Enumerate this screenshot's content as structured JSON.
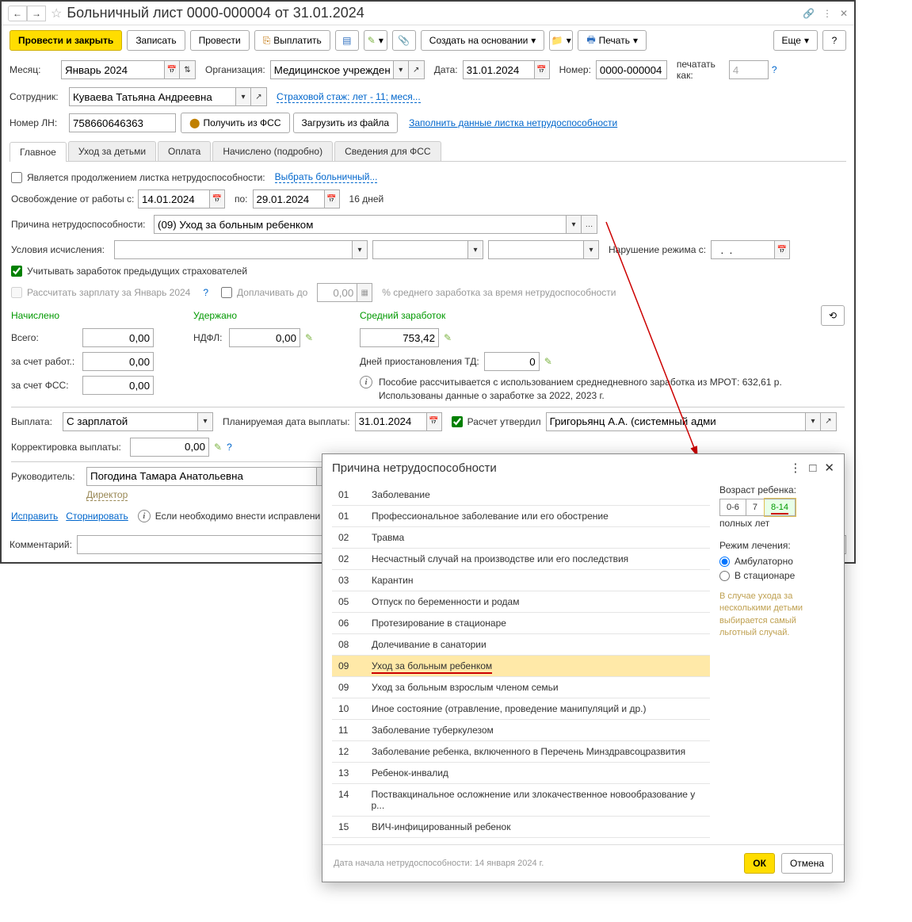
{
  "title": "Больничный лист 0000-000004 от 31.01.2024",
  "toolbar": {
    "post_close": "Провести и закрыть",
    "write": "Записать",
    "post": "Провести",
    "pay": "Выплатить",
    "create_based": "Создать на основании",
    "print": "Печать",
    "more": "Еще",
    "help": "?"
  },
  "fields": {
    "month_lbl": "Месяц:",
    "month": "Январь 2024",
    "org_lbl": "Организация:",
    "org": "Медицинское учреждение",
    "date_lbl": "Дата:",
    "date": "31.01.2024",
    "number_lbl": "Номер:",
    "number": "0000-000004",
    "print_as_lbl": "печатать как:",
    "print_as": "4",
    "employee_lbl": "Сотрудник:",
    "employee": "Куваева Татьяна Андреевна",
    "insurance_link": "Страховой стаж: лет - 11; меся...",
    "ln_lbl": "Номер ЛН:",
    "ln": "758660646363",
    "get_fss": "Получить из ФСС",
    "load_file": "Загрузить из файла",
    "fill_link": "Заполнить данные листка нетрудоспособности"
  },
  "tabs": [
    "Главное",
    "Уход за детьми",
    "Оплата",
    "Начислено (подробно)",
    "Сведения для ФСС"
  ],
  "main": {
    "continuation_lbl": "Является продолжением листка нетрудоспособности:",
    "select_sick": "Выбрать больничный...",
    "release_lbl": "Освобождение от работы с:",
    "date_from": "14.01.2024",
    "to_lbl": "по:",
    "date_to": "29.01.2024",
    "days": "16 дней",
    "reason_lbl": "Причина нетрудоспособности:",
    "reason": "(09) Уход за больным ребенком",
    "conditions_lbl": "Условия исчисления:",
    "violation_lbl": "Нарушение режима с:",
    "violation_date": "  .  .    ",
    "consider_prev": "Учитывать заработок предыдущих страхователей",
    "calc_salary": "Рассчитать зарплату за Январь 2024",
    "pay_up_to": "Доплачивать до",
    "pay_up_val": "0,00",
    "percent_hint": "% среднего заработка за время нетрудоспособности",
    "accrued": "Начислено",
    "withheld": "Удержано",
    "avg_earn": "Средний заработок",
    "total_lbl": "Всего:",
    "total": "0,00",
    "ndfl_lbl": "НДФЛ:",
    "ndfl": "0,00",
    "avg_val": "753,42",
    "employer_lbl": "за счет работ.:",
    "employer_val": "0,00",
    "suspend_lbl": "Дней приостановления ТД:",
    "suspend_val": "0",
    "fss_lbl": "за счет ФСС:",
    "fss_val": "0,00",
    "benefit_info": "Пособие рассчитывается с использованием среднедневного заработка из МРОТ: 632,61 р.\nИспользованы данные о заработке за  2022,  2023 г.",
    "payment_lbl": "Выплата:",
    "payment": "С зарплатой",
    "planned_lbl": "Планируемая дата выплаты:",
    "planned_date": "31.01.2024",
    "approved_lbl": "Расчет утвердил",
    "approved_by": "Григорьянц А.А. (системный адми",
    "correction_lbl": "Корректировка выплаты:",
    "correction": "0,00",
    "manager_lbl": "Руководитель:",
    "manager": "Погодина Тамара Анатольевна",
    "director": "Директор",
    "fix_link": "Исправить",
    "reverse_link": "Сторнировать",
    "fix_hint": "Если необходимо внести исправлени",
    "comment_lbl": "Комментарий:"
  },
  "dialog": {
    "title": "Причина нетрудоспособности",
    "reasons": [
      {
        "code": "01",
        "name": "Заболевание"
      },
      {
        "code": "01",
        "name": "Профессиональное заболевание или его обострение"
      },
      {
        "code": "02",
        "name": "Травма"
      },
      {
        "code": "02",
        "name": "Несчастный случай на производстве или его последствия"
      },
      {
        "code": "03",
        "name": "Карантин"
      },
      {
        "code": "05",
        "name": "Отпуск по беременности и родам"
      },
      {
        "code": "06",
        "name": "Протезирование в стационаре"
      },
      {
        "code": "08",
        "name": "Долечивание в санатории"
      },
      {
        "code": "09",
        "name": "Уход за больным ребенком",
        "selected": true
      },
      {
        "code": "09",
        "name": "Уход за больным взрослым членом семьи"
      },
      {
        "code": "10",
        "name": "Иное состояние (отравление, проведение манипуляций и др.)"
      },
      {
        "code": "11",
        "name": "Заболевание туберкулезом"
      },
      {
        "code": "12",
        "name": "Заболевание ребенка, включенного в Перечень Минздравсоцразвития"
      },
      {
        "code": "13",
        "name": "Ребенок-инвалид"
      },
      {
        "code": "14",
        "name": "Поствакцинальное осложнение или злокачественное новообразование у р..."
      },
      {
        "code": "15",
        "name": "ВИЧ-инфицированный ребенок"
      }
    ],
    "age_lbl": "Возраст ребенка:",
    "age_opts": [
      "0-6",
      "7",
      "8-14"
    ],
    "age_hint": "полных лет",
    "mode_lbl": "Режим лечения:",
    "mode_opts": [
      "Амбулаторно",
      "В стационаре"
    ],
    "hint": "В случае ухода за несколькими детьми выбирается самый льготный случай.",
    "start_date": "Дата начала нетрудоспособности: 14 января 2024 г.",
    "ok": "ОК",
    "cancel": "Отмена"
  }
}
